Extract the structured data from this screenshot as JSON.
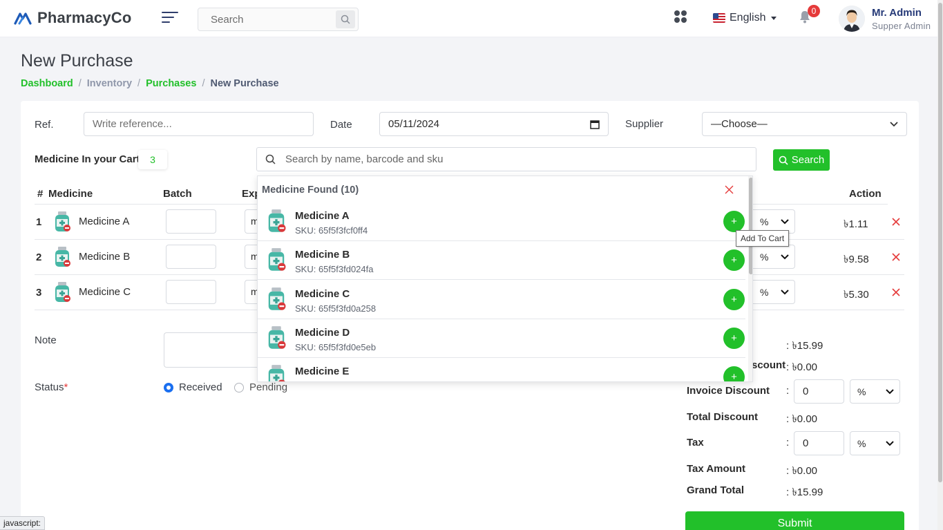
{
  "header": {
    "brand": "PharmacyCo",
    "search_placeholder": "Search",
    "language": "English",
    "notification_count": "0",
    "user_name": "Mr. Admin",
    "user_role": "Supper Admin"
  },
  "page": {
    "title": "New Purchase",
    "breadcrumb": [
      "Dashboard",
      "Inventory",
      "Purchases",
      "New Purchase"
    ]
  },
  "form": {
    "ref_label": "Ref.",
    "ref_placeholder": "Write reference...",
    "date_label": "Date",
    "date_value": "05/11/2024",
    "supplier_label": "Supplier",
    "supplier_value": "—Choose—",
    "cart_title": "Medicine In your Cart",
    "cart_count": "3",
    "search_placeholder": "Search by name, barcode and sku",
    "search_button": "Search"
  },
  "table": {
    "headers": {
      "num": "#",
      "medicine": "Medicine",
      "batch": "Batch",
      "expiry": "Exp",
      "action": "Action"
    },
    "rows": [
      {
        "num": "1",
        "name": "Medicine A",
        "expiry_partial": "m",
        "discount_type": "%",
        "price": "৳1.11"
      },
      {
        "num": "2",
        "name": "Medicine B",
        "expiry_partial": "m",
        "discount_type": "%",
        "price": "৳9.58"
      },
      {
        "num": "3",
        "name": "Medicine C",
        "expiry_partial": "m",
        "discount_type": "%",
        "price": "৳5.30"
      }
    ]
  },
  "note_label": "Note",
  "status": {
    "label": "Status",
    "required_mark": "*",
    "options": [
      "Received",
      "Pending"
    ],
    "selected": "Received"
  },
  "summary": {
    "subtotal_value": ": ৳15.99",
    "discount_label_partial": "scount",
    "discount_value": ": ৳0.00",
    "invoice_discount_label": "Invoice Discount",
    "invoice_discount_colon": ":",
    "invoice_discount_value": "0",
    "invoice_discount_type": "%",
    "total_discount_label": "Total Discount",
    "total_discount_value": ": ৳0.00",
    "tax_label": "Tax",
    "tax_colon": ":",
    "tax_value": "0",
    "tax_type": "%",
    "tax_amount_label": "Tax Amount",
    "tax_amount_value": ": ৳0.00",
    "grand_total_label": "Grand Total",
    "grand_total_value": ": ৳15.99",
    "submit": "Submit"
  },
  "dropdown": {
    "title": "Medicine Found (10)",
    "items": [
      {
        "name": "Medicine A",
        "sku": "SKU: 65f5f3fcf0ff4"
      },
      {
        "name": "Medicine B",
        "sku": "SKU: 65f5f3fd024fa"
      },
      {
        "name": "Medicine C",
        "sku": "SKU: 65f5f3fd0a258"
      },
      {
        "name": "Medicine D",
        "sku": "SKU: 65f5f3fd0e5eb"
      },
      {
        "name": "Medicine E",
        "sku": ""
      }
    ],
    "add_symbol": "+",
    "tooltip": "Add To Cart"
  },
  "statusbar": "javascript:",
  "colors": {
    "accent_green": "#22c02a",
    "danger_red": "#e53a3a",
    "brand_blue": "#1e5bb8",
    "user_name_blue": "#263a78"
  }
}
